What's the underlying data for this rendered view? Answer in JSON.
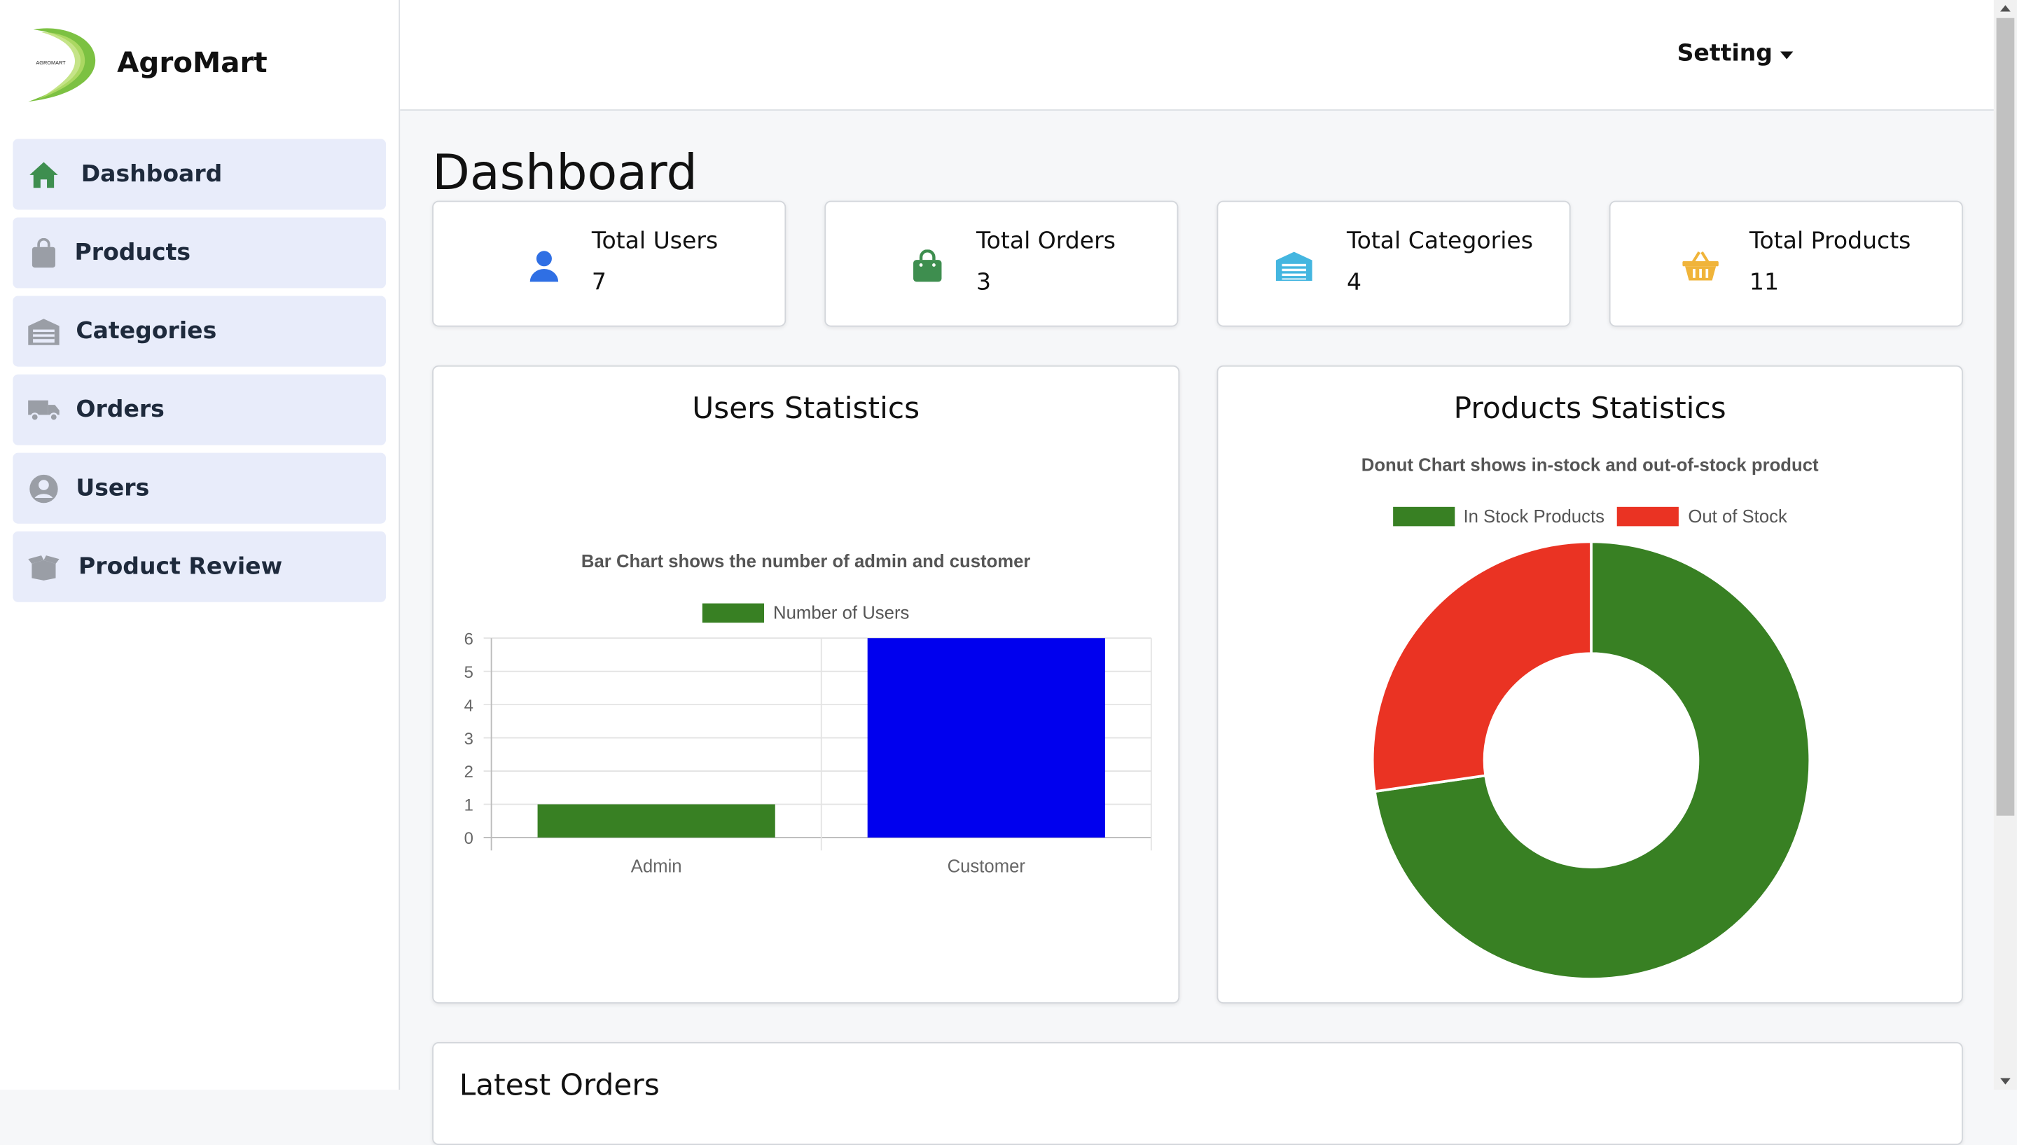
{
  "brand": {
    "name": "AgroMart",
    "logo_text": "AGROMART"
  },
  "sidebar": {
    "items": [
      {
        "label": "Dashboard",
        "icon": "home-icon"
      },
      {
        "label": "Products",
        "icon": "shopping-bag-icon"
      },
      {
        "label": "Categories",
        "icon": "warehouse-icon"
      },
      {
        "label": "Orders",
        "icon": "truck-icon"
      },
      {
        "label": "Users",
        "icon": "user-circle-icon"
      },
      {
        "label": "Product Review",
        "icon": "open-box-icon"
      }
    ]
  },
  "topbar": {
    "setting_label": "Setting"
  },
  "page": {
    "title": "Dashboard"
  },
  "stats": [
    {
      "label": "Total Users",
      "value": "7",
      "icon": "user-icon",
      "color": "#2f6fe4"
    },
    {
      "label": "Total Orders",
      "value": "3",
      "icon": "shopping-bag-icon",
      "color": "#3e8e4f"
    },
    {
      "label": "Total Categories",
      "value": "4",
      "icon": "warehouse-icon",
      "color": "#44b6e0"
    },
    {
      "label": "Total Products",
      "value": "11",
      "icon": "basket-icon",
      "color": "#f0b43a"
    }
  ],
  "users_panel": {
    "title": "Users Statistics",
    "subtitle": "Bar Chart shows the number of admin and customer",
    "legend": "Number of Users"
  },
  "products_panel": {
    "title": "Products Statistics",
    "subtitle": "Donut Chart shows in-stock and out-of-stock product",
    "legend": [
      "In Stock Products",
      "Out of Stock"
    ]
  },
  "orders_panel": {
    "title": "Latest Orders"
  },
  "colors": {
    "green": "#388023",
    "blue": "#0000ee",
    "red": "#ea3323",
    "nav_bg": "#e8ecfa"
  },
  "chart_data": [
    {
      "type": "bar",
      "title": "Bar Chart shows the number of admin and customer",
      "categories": [
        "Admin",
        "Customer"
      ],
      "series": [
        {
          "name": "Number of Users",
          "values": [
            1,
            6
          ],
          "colors": [
            "#388023",
            "#0000ee"
          ]
        }
      ],
      "yticks": [
        0,
        1,
        2,
        3,
        4,
        5,
        6
      ],
      "ylim": [
        0,
        6
      ],
      "grid": true,
      "legend_position": "top"
    },
    {
      "type": "pie",
      "title": "Donut Chart shows in-stock and out-of-stock product",
      "labels": [
        "In Stock Products",
        "Out of Stock"
      ],
      "values": [
        8,
        3
      ],
      "colors": [
        "#388023",
        "#ea3323"
      ],
      "donut": true,
      "legend_position": "top"
    }
  ]
}
